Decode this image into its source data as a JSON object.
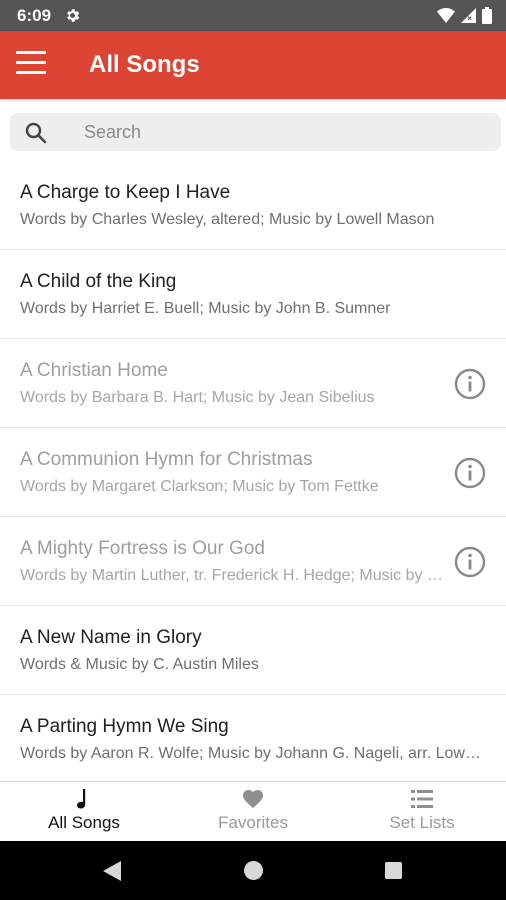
{
  "status_bar": {
    "time": "6:09"
  },
  "app_bar": {
    "title": "All Songs"
  },
  "search": {
    "placeholder": "Search",
    "value": ""
  },
  "songs": [
    {
      "title": "A Charge to Keep I Have",
      "credits": "Words by Charles Wesley, altered; Music by Lowell Mason",
      "available": true
    },
    {
      "title": "A Child of the King",
      "credits": "Words by Harriet E. Buell; Music by John B. Sumner",
      "available": true
    },
    {
      "title": "A Christian Home",
      "credits": "Words by Barbara B. Hart; Music by Jean Sibelius",
      "available": false
    },
    {
      "title": "A Communion Hymn for Christmas",
      "credits": "Words by Margaret Clarkson; Music by Tom Fettke",
      "available": false
    },
    {
      "title": "A Mighty Fortress is Our God",
      "credits": "Words by Martin Luther, tr. Frederick H. Hedge; Music by Martin Luther",
      "available": false
    },
    {
      "title": "A New Name in Glory",
      "credits": "Words & Music by C. Austin Miles",
      "available": true
    },
    {
      "title": "A Parting Hymn We Sing",
      "credits": "Words by Aaron R. Wolfe; Music by Johann G. Nageli, arr. Lowell Mason",
      "available": true
    }
  ],
  "bottom_nav": {
    "tabs": [
      {
        "label": "All Songs",
        "icon": "music-note-icon",
        "active": true
      },
      {
        "label": "Favorites",
        "icon": "heart-icon",
        "active": false
      },
      {
        "label": "Set Lists",
        "icon": "list-icon",
        "active": false
      }
    ]
  },
  "colors": {
    "app_bar": "#dc4533",
    "status_bar": "#555555",
    "active_tab": "#111111",
    "inactive_tab": "#9a9a9a"
  }
}
